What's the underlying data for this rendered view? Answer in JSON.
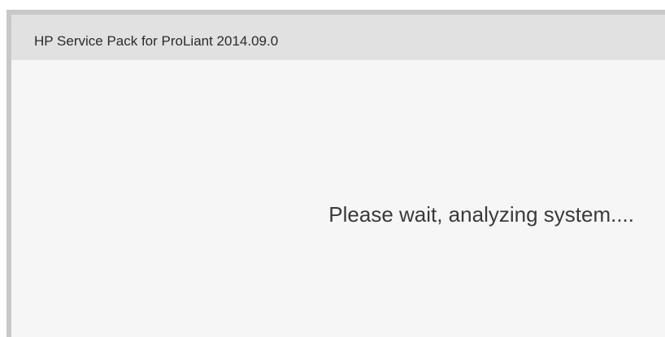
{
  "window": {
    "title": "HP Service Pack for ProLiant 2014.09.0"
  },
  "content": {
    "status_message": "Please wait, analyzing system...."
  },
  "colors": {
    "title_bar_bg": "#e1e1e1",
    "content_bg": "#f6f6f6",
    "frame_border": "#c8c8c8",
    "text": "#2b2b2b"
  }
}
